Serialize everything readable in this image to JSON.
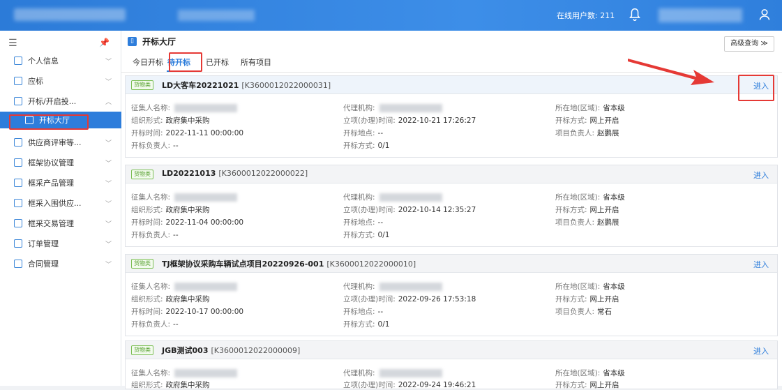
{
  "topbar": {
    "online_users": "在线用户数: 211"
  },
  "sidebar": {
    "items": [
      {
        "label": "个人信息"
      },
      {
        "label": "应标"
      },
      {
        "label": "开标/开启投..."
      },
      {
        "label": "开标大厅"
      },
      {
        "label": "供应商评审等..."
      },
      {
        "label": "框架协议管理"
      },
      {
        "label": "框采产品管理"
      },
      {
        "label": "框采入围供应..."
      },
      {
        "label": "框采交易管理"
      },
      {
        "label": "订单管理"
      },
      {
        "label": "合同管理"
      }
    ]
  },
  "main": {
    "title": "开标大厅",
    "advanced_search": "高级查询 ≫",
    "tabs": [
      "今日开标",
      "待开标",
      "已开标",
      "所有项目"
    ],
    "labels": {
      "collector": "征集人名称:",
      "agency": "代理机构:",
      "region": "所在地(区域):",
      "org_form": "组织形式:",
      "setup_time": "立项(办理)时间:",
      "open_mode": "开标方式:",
      "open_time": "开标时间:",
      "open_place": "开标地点:",
      "proj_leader": "项目负责人:",
      "open_leader": "开标负责人:",
      "open_method": "开标方式:"
    },
    "enter": "进入",
    "cards": [
      {
        "tag": "货物类",
        "name": "LD大客车20221021",
        "code": "[K3600012022000031]",
        "region": "省本级",
        "org_form": "政府集中采购",
        "setup_time": "2022-10-21 17:26:27",
        "open_mode": "网上开启",
        "open_time": "2022-11-11 00:00:00",
        "open_place": "--",
        "proj_leader": "赵鹏展",
        "open_leader": "--",
        "open_method": "0/1"
      },
      {
        "tag": "货物类",
        "name": "LD20221013",
        "code": "[K3600012022000022]",
        "region": "省本级",
        "org_form": "政府集中采购",
        "setup_time": "2022-10-14 12:35:27",
        "open_mode": "网上开启",
        "open_time": "2022-11-04 00:00:00",
        "open_place": "--",
        "proj_leader": "赵鹏展",
        "open_leader": "--",
        "open_method": "0/1"
      },
      {
        "tag": "货物类",
        "name": "TJ框架协议采购车辆试点项目20220926-001",
        "code": "[K3600012022000010]",
        "region": "省本级",
        "org_form": "政府集中采购",
        "setup_time": "2022-09-26 17:53:18",
        "open_mode": "网上开启",
        "open_time": "2022-10-17 00:00:00",
        "open_place": "--",
        "proj_leader": "常石",
        "open_leader": "--",
        "open_method": "0/1"
      },
      {
        "tag": "货物类",
        "name": "JGB测试003",
        "code": "[K3600012022000009]",
        "region": "省本级",
        "org_form": "政府集中采购",
        "setup_time": "2022-09-24 19:46:21",
        "open_mode": "网上开启"
      }
    ]
  }
}
